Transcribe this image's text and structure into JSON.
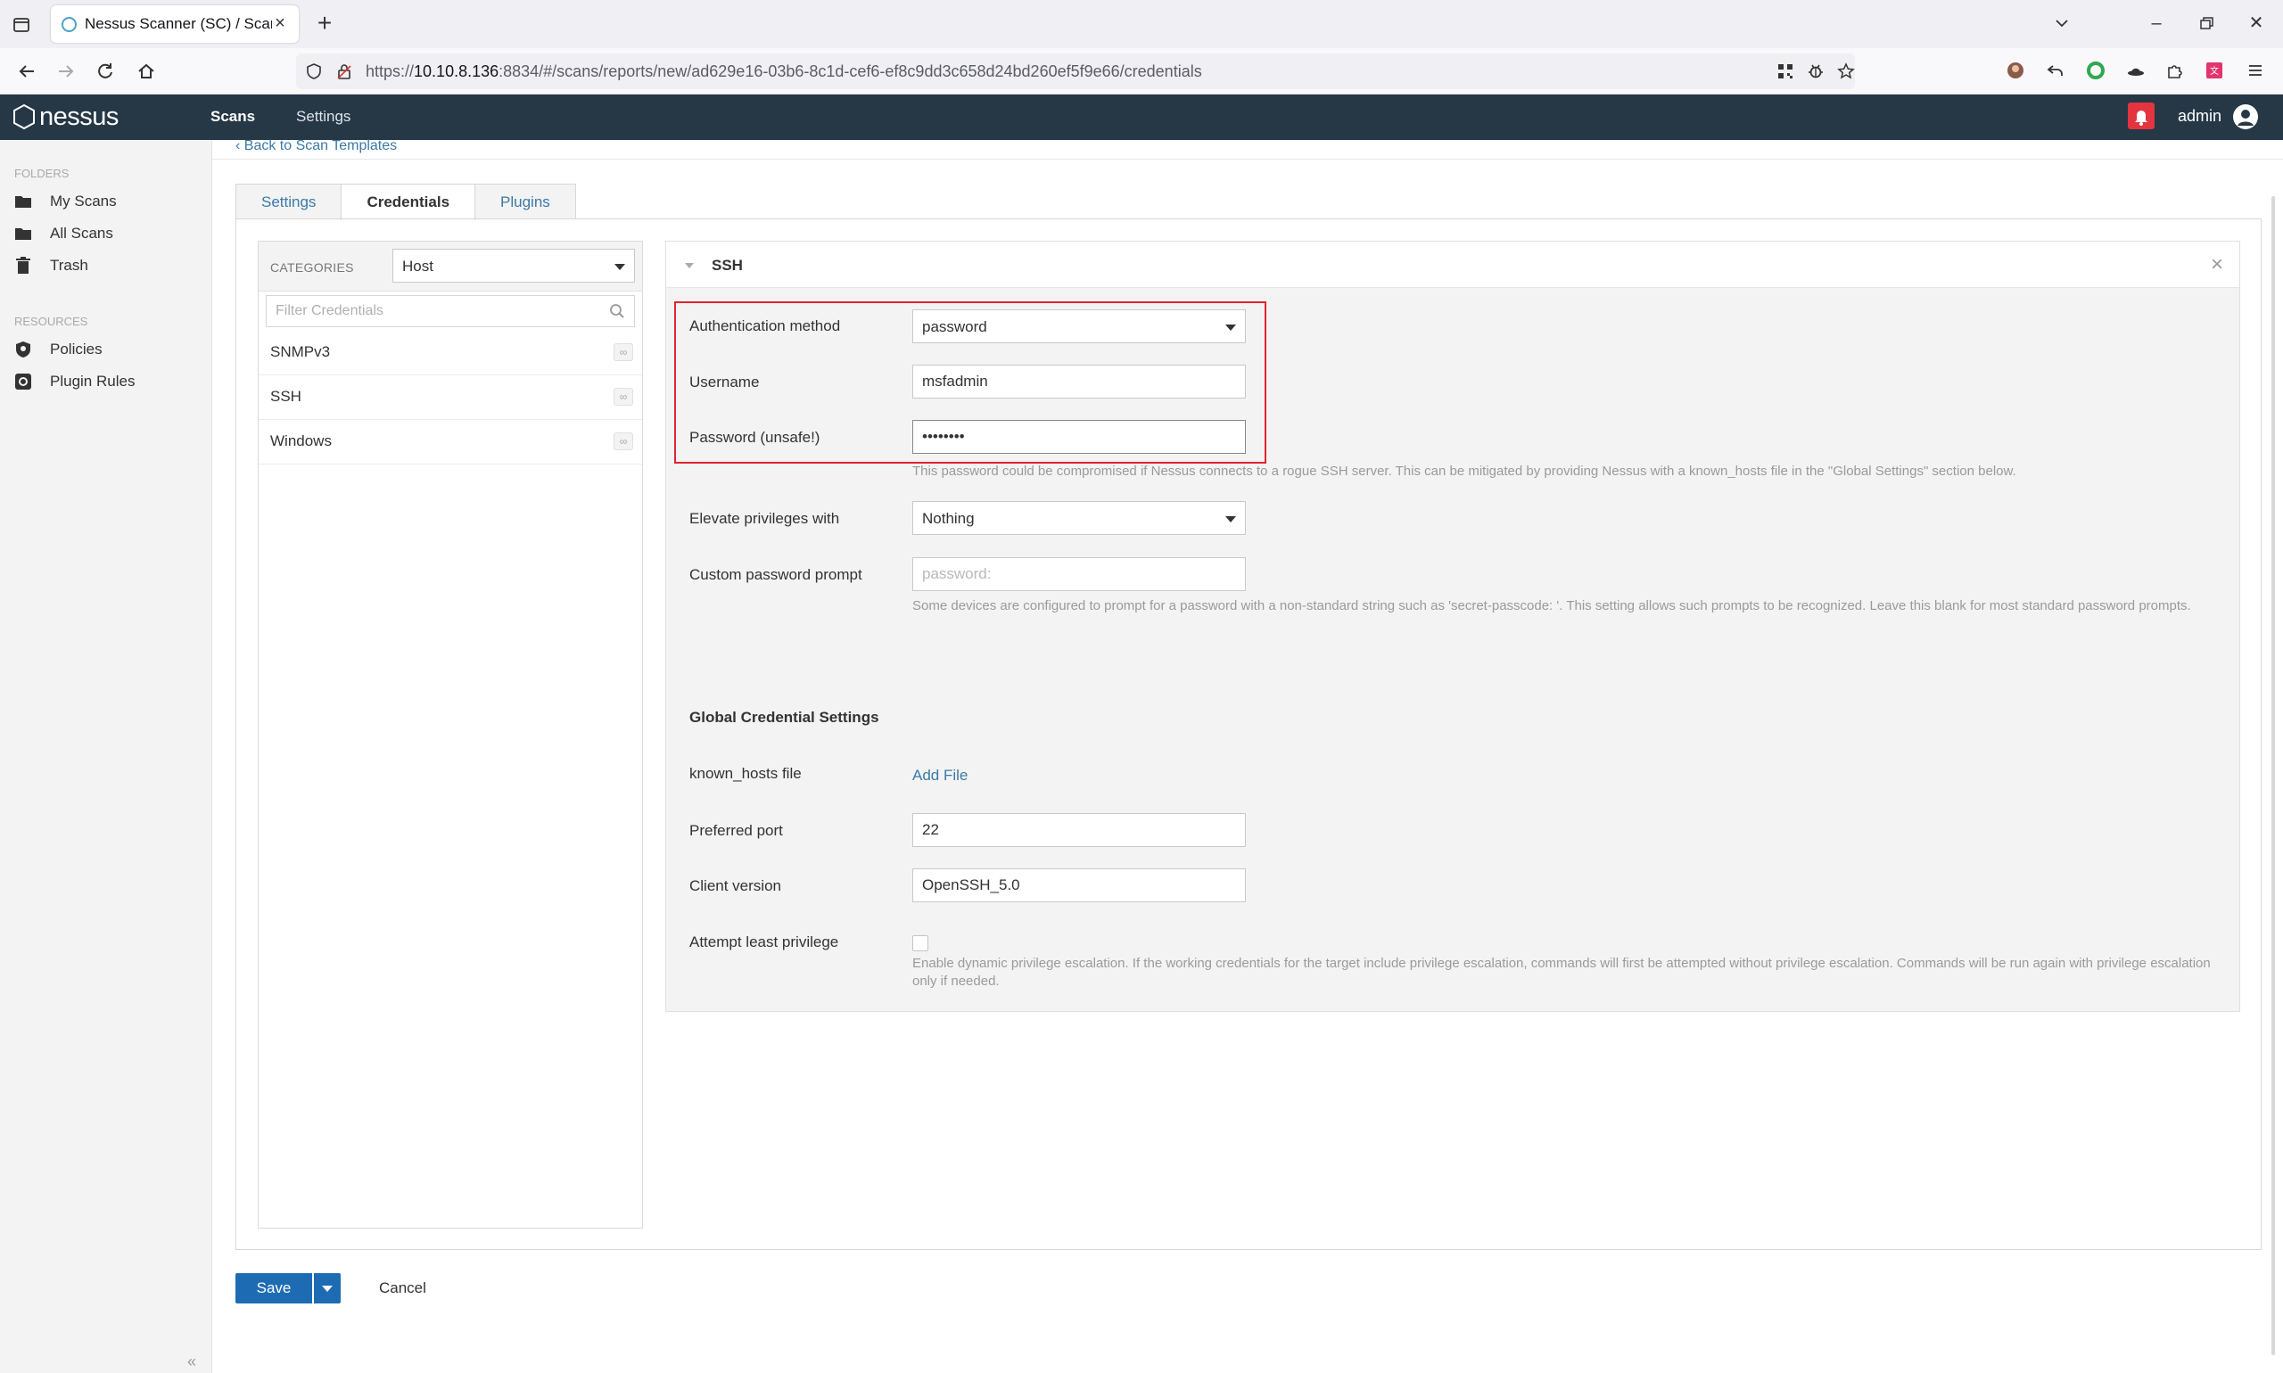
{
  "browser": {
    "tab_title": "Nessus Scanner (SC) / Scans",
    "url_prefix": "https://",
    "url_host": "10.10.8.136",
    "url_rest": ":8834/#/scans/reports/new/ad629e16-03b6-8c1d-cef6-ef8c9dd3c658d24bd260ef5f9e66/credentials"
  },
  "app": {
    "logo": "nessus",
    "nav": {
      "scans": "Scans",
      "settings": "Settings"
    },
    "user": "admin",
    "colors": {
      "header": "#263746",
      "link": "#3b79a8",
      "primary": "#1d6cb3",
      "alert": "#e3343f"
    }
  },
  "sidebar": {
    "folders_heading": "FOLDERS",
    "folders": [
      {
        "label": "My Scans",
        "icon": "folder-icon"
      },
      {
        "label": "All Scans",
        "icon": "folder-icon"
      },
      {
        "label": "Trash",
        "icon": "trash-icon"
      }
    ],
    "resources_heading": "RESOURCES",
    "resources": [
      {
        "label": "Policies",
        "icon": "shield-icon"
      },
      {
        "label": "Plugin Rules",
        "icon": "plugin-rules-icon"
      }
    ]
  },
  "page": {
    "back_link": "Back to Scan Templates",
    "tabs": [
      {
        "label": "Settings",
        "active": false
      },
      {
        "label": "Credentials",
        "active": true
      },
      {
        "label": "Plugins",
        "active": false
      }
    ]
  },
  "categories": {
    "label": "CATEGORIES",
    "selected": "Host",
    "filter_placeholder": "Filter Credentials",
    "items": [
      {
        "label": "SNMPv3",
        "count": "∞"
      },
      {
        "label": "SSH",
        "count": "∞"
      },
      {
        "label": "Windows",
        "count": "∞"
      }
    ]
  },
  "ssh": {
    "title": "SSH",
    "auth_method_label": "Authentication method",
    "auth_method_value": "password",
    "username_label": "Username",
    "username_value": "msfadmin",
    "password_label": "Password (unsafe!)",
    "password_value": "msfadmin",
    "password_help": "This password could be compromised if Nessus connects to a rogue SSH server. This can be mitigated by providing Nessus with a known_hosts file in the \"Global Settings\" section below.",
    "elevate_label": "Elevate privileges with",
    "elevate_value": "Nothing",
    "prompt_label": "Custom password prompt",
    "prompt_placeholder": "password:",
    "prompt_help": "Some devices are configured to prompt for a password with a non-standard string such as 'secret-passcode: '. This setting allows such prompts to be recognized. Leave this blank for most standard password prompts.",
    "global_title": "Global Credential Settings",
    "known_hosts_label": "known_hosts file",
    "add_file": "Add File",
    "port_label": "Preferred port",
    "port_value": "22",
    "client_label": "Client version",
    "client_value": "OpenSSH_5.0",
    "least_priv_label": "Attempt least privilege",
    "least_priv_checked": false,
    "least_priv_help": "Enable dynamic privilege escalation. If the working credentials for the target include privilege escalation, commands will first be attempted without privilege escalation. Commands will be run again with privilege escalation only if needed."
  },
  "actions": {
    "save": "Save",
    "cancel": "Cancel"
  }
}
